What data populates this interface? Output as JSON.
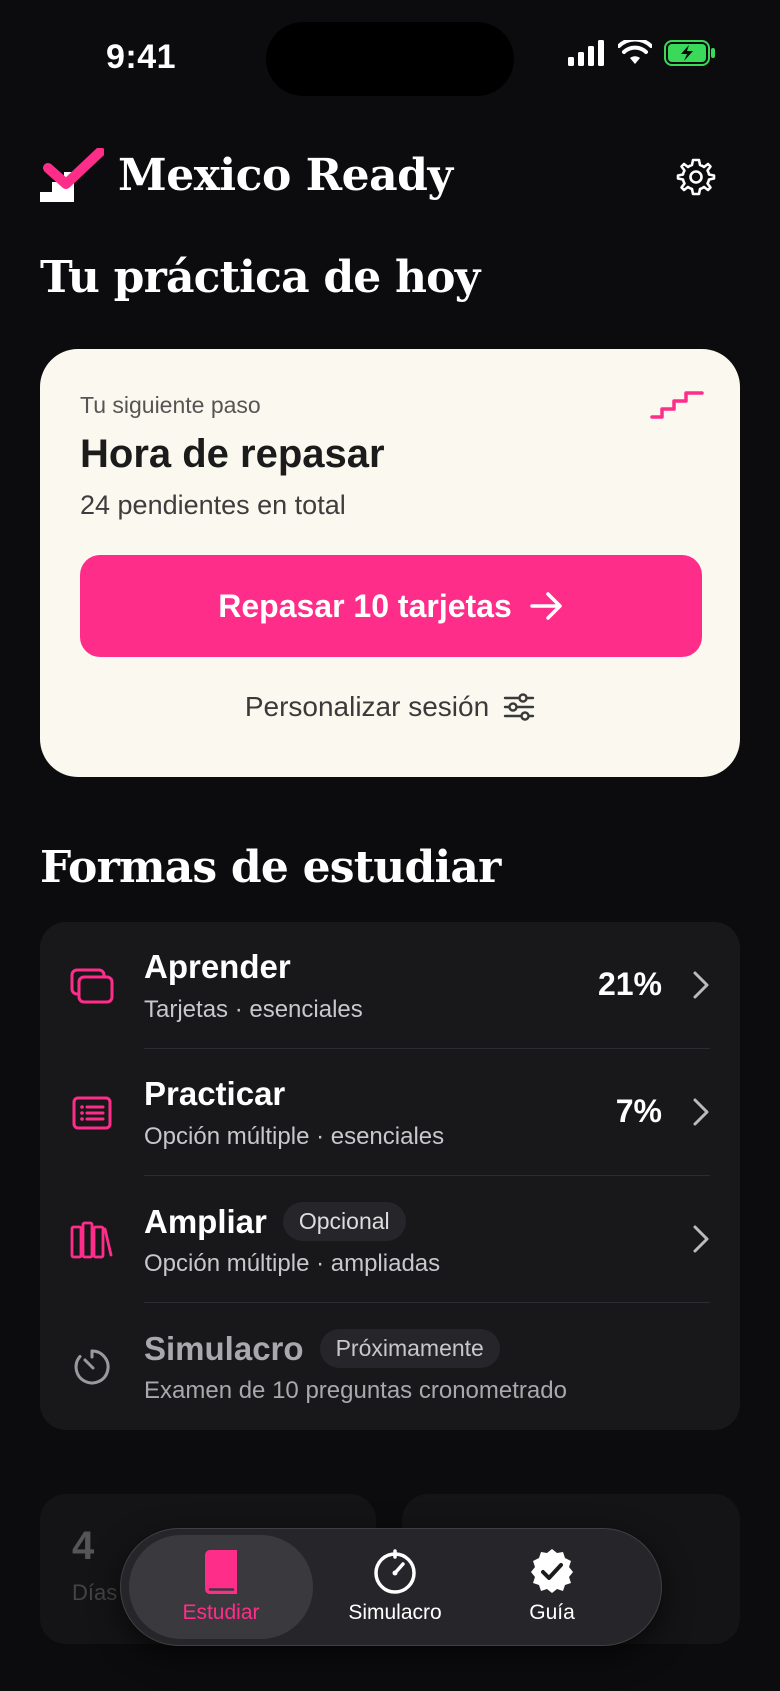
{
  "status_bar": {
    "time": "9:41"
  },
  "header": {
    "app_title": "Mexico Ready"
  },
  "today": {
    "heading": "Tu práctica de hoy",
    "card": {
      "kicker": "Tu siguiente paso",
      "title": "Hora de repasar",
      "subtitle": "24 pendientes en total",
      "cta_label": "Repasar 10 tarjetas",
      "customize_label": "Personalizar sesión"
    }
  },
  "study": {
    "heading": "Formas de estudiar",
    "modes": [
      {
        "title": "Aprender",
        "subtitle": "Tarjetas · esenciales",
        "percent": "21%",
        "icon": "cards-icon"
      },
      {
        "title": "Practicar",
        "subtitle": "Opción múltiple · esenciales",
        "percent": "7%",
        "icon": "list-icon"
      },
      {
        "title": "Ampliar",
        "badge": "Opcional",
        "subtitle": "Opción múltiple · ampliadas",
        "icon": "books-icon"
      },
      {
        "title": "Simulacro",
        "badge": "Próximamente",
        "subtitle": "Examen de 10 preguntas cronometrado",
        "icon": "timer-icon"
      }
    ]
  },
  "stats": [
    {
      "value": "4",
      "label": "Días"
    }
  ],
  "tabbar": {
    "tabs": [
      {
        "label": "Estudiar",
        "icon": "book-icon",
        "active": true
      },
      {
        "label": "Simulacro",
        "icon": "timer-icon",
        "active": false
      },
      {
        "label": "Guía",
        "icon": "badge-check-icon",
        "active": false
      }
    ]
  },
  "colors": {
    "accent": "#ff2d8a",
    "background": "#0c0c0e",
    "card": "#fbf8ef",
    "list_bg": "#18181b"
  }
}
